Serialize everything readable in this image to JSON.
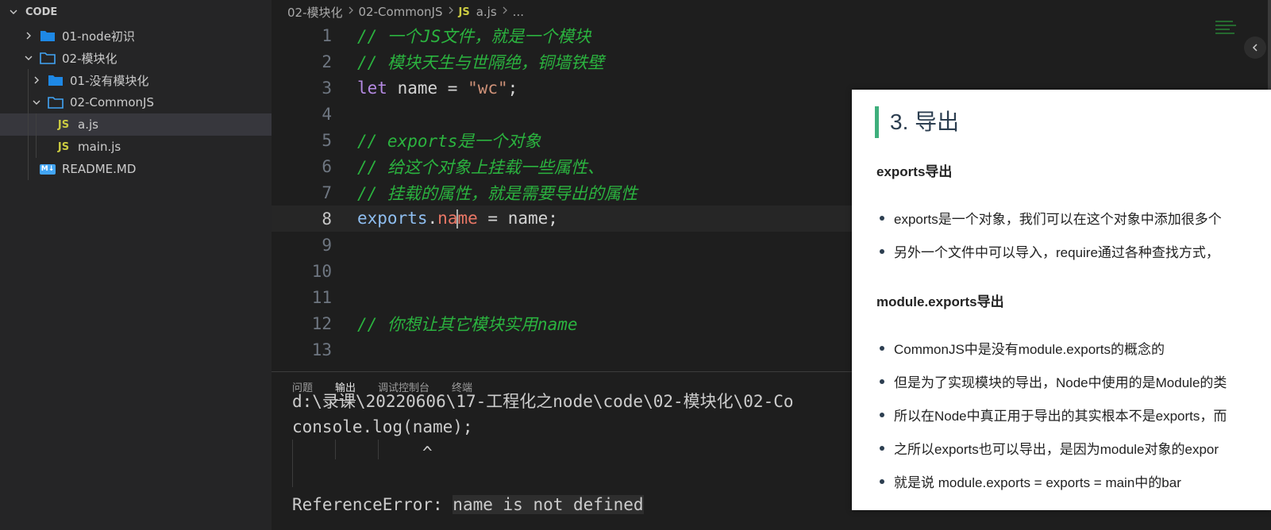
{
  "explorer": {
    "section_title": "CODE",
    "items": [
      {
        "label": "01-node初识"
      },
      {
        "label": "02-模块化"
      },
      {
        "label": "01-没有模块化"
      },
      {
        "label": "02-CommonJS"
      },
      {
        "label": "a.js",
        "badge": "JS"
      },
      {
        "label": "main.js",
        "badge": "JS"
      },
      {
        "label": "README.MD",
        "badge": "M↓"
      }
    ]
  },
  "breadcrumb": {
    "parts": [
      "02-模块化",
      "02-CommonJS"
    ],
    "file_badge": "JS",
    "file": "a.js",
    "ellipsis": "..."
  },
  "editor": {
    "line_numbers": [
      "1",
      "2",
      "3",
      "4",
      "5",
      "6",
      "7",
      "8",
      "9",
      "10",
      "11",
      "12",
      "13"
    ],
    "line1": "// 一个JS文件，就是一个模块",
    "line2": "// 模块天生与世隔绝，铜墙铁壁",
    "line3_kw": "let",
    "line3_mid": " name = ",
    "line3_str": "\"wc\"",
    "line3_end": ";",
    "line5": "// exports是一个对象",
    "line6": "// 给这个对象上挂载一些属性、",
    "line7": "// 挂载的属性，就是需要导出的属性",
    "line8_obj": "exports",
    "line8_dot": ".",
    "line8_prop_a": "na",
    "line8_prop_b": "me",
    "line8_rest": " = name;",
    "line12": "// 你想让其它模块实用name"
  },
  "panel": {
    "tabs": [
      "问题",
      "输出",
      "调试控制台",
      "终端"
    ],
    "active_tab": "输出",
    "output": {
      "path": "d:\\录课\\20220606\\17-工程化之node\\code\\02-模块化\\02-Co",
      "code": "console.log(name);",
      "caret": "^",
      "err_label": "ReferenceError: ",
      "err_msg": "name is not defined"
    }
  },
  "doc": {
    "heading": "3. 导出",
    "sub1": "exports导出",
    "b1": "exports是一个对象，我们可以在这个对象中添加很多个",
    "b2": "另外一个文件中可以导入，require通过各种查找方式，",
    "sub2": "module.exports导出",
    "b3": "CommonJS中是没有module.exports的概念的",
    "b4": "但是为了实现模块的导出，Node中使用的是Module的类",
    "b5": "所以在Node中真正用于导出的其实根本不是exports，而",
    "b6": "之所以exports也可以导出，是因为module对象的expor",
    "b7": "就是说 module.exports = exports = main中的bar"
  },
  "colors": {
    "comment": "#2bb33f",
    "keyword": "#b58ae3",
    "accent": "#3eaf7c",
    "js_badge": "#cbcb41"
  }
}
